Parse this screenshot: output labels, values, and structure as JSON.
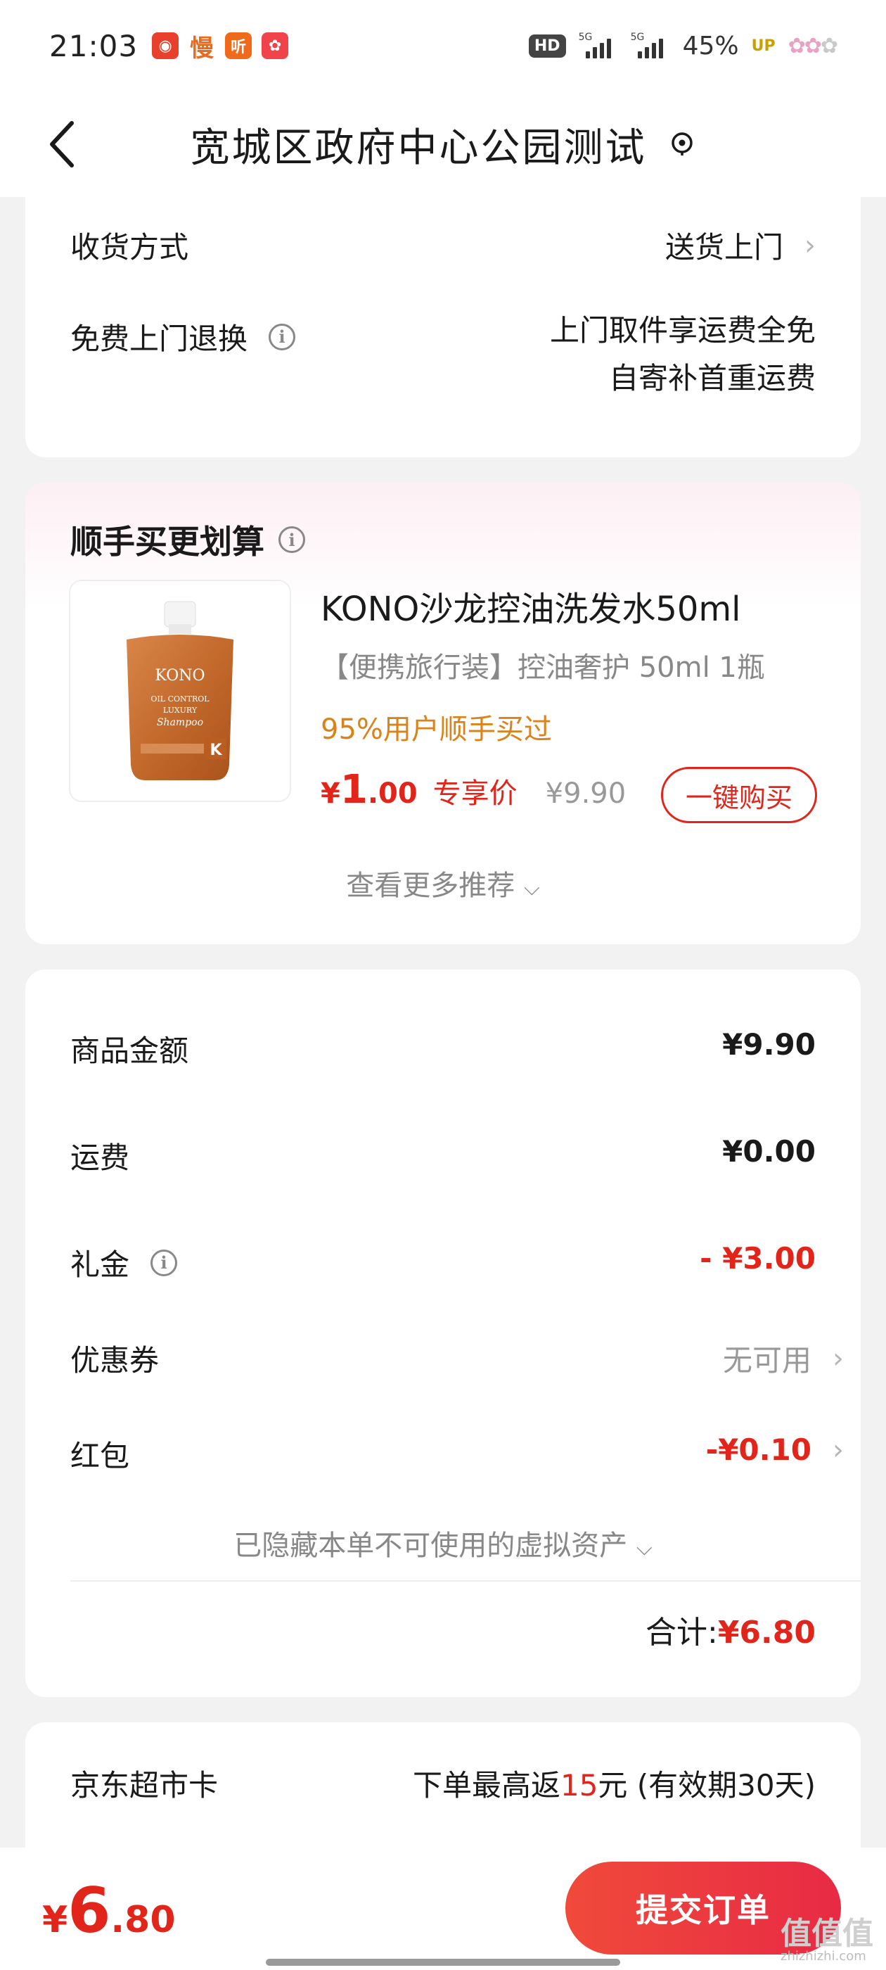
{
  "status_bar": {
    "time": "21:03",
    "apps": [
      "netease-music-icon",
      "manman-icon",
      "ting-icon",
      "xiaohongshu-icon"
    ],
    "hd": "HD",
    "network": "5G",
    "battery": "45%",
    "up": "UP"
  },
  "nav": {
    "title": "宽城区政府中心公园测试"
  },
  "delivery": {
    "method_label": "收货方式",
    "method_value": "送货上门",
    "return_label": "免费上门退换",
    "return_value_1": "上门取件享运费全免",
    "return_value_2": "自寄补首重运费"
  },
  "recommend": {
    "title": "顺手买更划算",
    "product_name": "KONO沙龙控油洗发水50ml",
    "product_spec": "【便携旅行装】控油奢护 50ml 1瓶",
    "product_tag": "95%用户顺手买过",
    "price_yen": "¥",
    "price_int": "1",
    "price_dec": ".00",
    "price_label": "专享价",
    "price_original": "¥9.90",
    "buy_button": "一键购买",
    "more": "查看更多推荐",
    "image_text": {
      "brand": "KONO",
      "line1": "OIL CONTROL",
      "line2": "LUXURY",
      "line3": "Shampoo",
      "mark": "K"
    }
  },
  "summary": {
    "goods_label": "商品金额",
    "goods_value": "¥9.90",
    "shipping_label": "运费",
    "shipping_value": "¥0.00",
    "gift_label": "礼金",
    "gift_value": "- ¥3.00",
    "coupon_label": "优惠券",
    "coupon_value": "无可用",
    "redpacket_label": "红包",
    "redpacket_value": "-¥0.10",
    "hidden_assets": "已隐藏本单不可使用的虚拟资产",
    "total_label": "合计:",
    "total_value": "¥6.80"
  },
  "jd_card": {
    "label": "京东超市卡",
    "text_pre": "下单最高返",
    "text_highlight": "15",
    "text_post": "元 (有效期30天)"
  },
  "bottom": {
    "price_yen": "¥",
    "price_int": "6",
    "price_dec": ".80",
    "submit": "提交订单"
  },
  "watermark": {
    "main": "值值值",
    "sub": "zhizhizhi.com"
  },
  "colors": {
    "accent_red": "#e1251b",
    "tag_orange": "#d9831a",
    "background": "#f2f2f2"
  }
}
